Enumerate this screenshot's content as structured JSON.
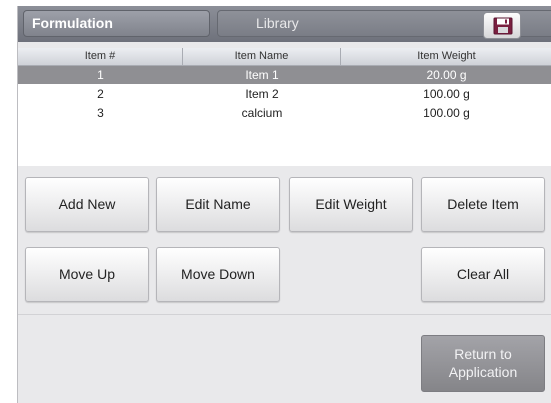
{
  "header": {
    "tab_formulation": "Formulation",
    "tab_library": "Library",
    "save_icon": "save-icon"
  },
  "table": {
    "columns": [
      "Item #",
      "Item Name",
      "Item Weight"
    ],
    "rows": [
      {
        "num": "1",
        "name": "Item 1",
        "weight": "20.00 g",
        "selected": true
      },
      {
        "num": "2",
        "name": "Item 2",
        "weight": "100.00 g",
        "selected": false
      },
      {
        "num": "3",
        "name": "calcium",
        "weight": "100.00 g",
        "selected": false
      }
    ]
  },
  "buttons": {
    "add_new": "Add New",
    "edit_name": "Edit Name",
    "edit_weight": "Edit Weight",
    "delete_item": "Delete Item",
    "move_up": "Move Up",
    "move_down": "Move Down",
    "clear_all": "Clear All",
    "return_line1": "Return to",
    "return_line2": "Application"
  },
  "colors": {
    "header": "#7d808a",
    "selected_row": "#8f8f93",
    "panel": "#e9e9eb"
  }
}
